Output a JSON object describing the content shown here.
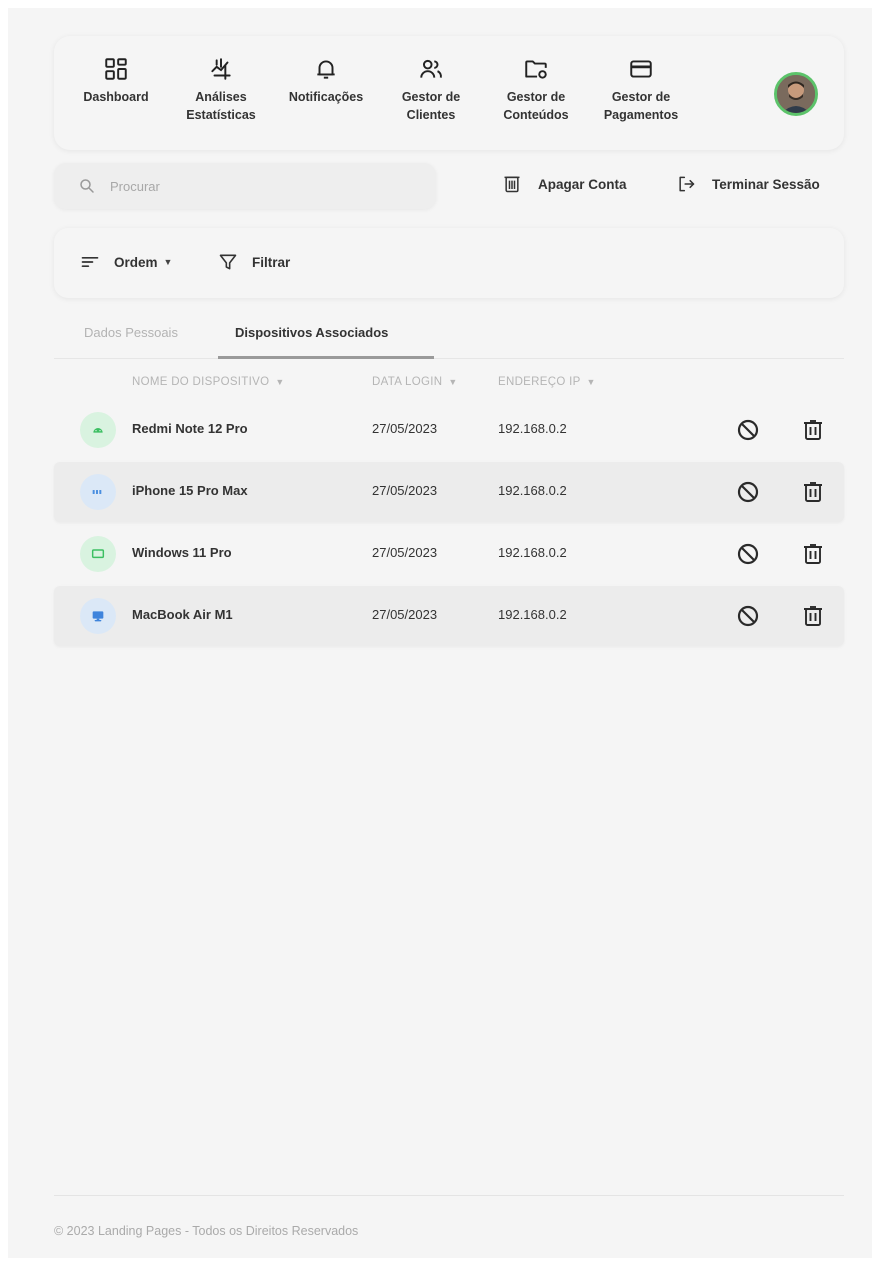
{
  "nav": {
    "items": [
      {
        "label": "Dashboard",
        "icon": "dashboard-grid-icon"
      },
      {
        "label": "Análises\nEstatísticas",
        "icon": "analytics-chart-icon"
      },
      {
        "label": "Notificações",
        "icon": "bell-icon"
      },
      {
        "label": "Gestor de\nClientes",
        "icon": "users-icon"
      },
      {
        "label": "Gestor de\nConteúdos",
        "icon": "folder-settings-icon"
      },
      {
        "label": "Gestor de\nPagamentos",
        "icon": "credit-card-icon"
      }
    ],
    "avatar_icon": "user-avatar"
  },
  "search": {
    "placeholder": "Procurar",
    "icon": "search-icon"
  },
  "actions": {
    "delete_account": "Apagar Conta",
    "logout": "Terminar Sessão"
  },
  "filterbar": {
    "order_label": "Ordem",
    "filter_label": "Filtrar"
  },
  "tabs": [
    {
      "label": "Dados Pessoais",
      "active": false
    },
    {
      "label": "Dispositivos Associados",
      "active": true
    }
  ],
  "table": {
    "headers": [
      "NOME DO DISPOSITIVO",
      "DATA LOGIN",
      "ENDEREÇO IP"
    ],
    "rows": [
      {
        "name": "Redmi Note 12 Pro",
        "date": "27/05/2023",
        "ip": "192.168.0.2",
        "device_icon": "android-icon",
        "icon_bg": "#d9f3e0",
        "icon_color": "#3cbf62"
      },
      {
        "name": "iPhone 15 Pro Max",
        "date": "27/05/2023",
        "ip": "192.168.0.2",
        "device_icon": "apple-icon",
        "icon_bg": "#dbe8f7",
        "icon_color": "#4a8fe0"
      },
      {
        "name": "Windows 11 Pro",
        "date": "27/05/2023",
        "ip": "192.168.0.2",
        "device_icon": "laptop-icon",
        "icon_bg": "#d9f3e0",
        "icon_color": "#3cbf62"
      },
      {
        "name": "MacBook Air M1",
        "date": "27/05/2023",
        "ip": "192.168.0.2",
        "device_icon": "monitor-icon",
        "icon_bg": "#dbe8f7",
        "icon_color": "#3f84dc"
      }
    ]
  },
  "footer": {
    "text": "© 2023 Landing Pages - Todos os Direitos Reservados"
  },
  "colors": {
    "background": "#f5f5f5",
    "accent_green": "#5cc36a",
    "accent_blue": "#4a8fe0"
  }
}
